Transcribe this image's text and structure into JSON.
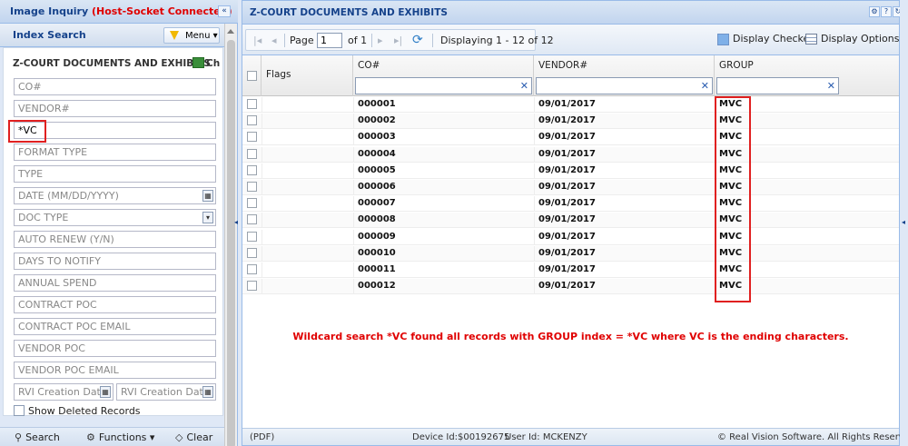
{
  "left": {
    "title": "Image Inquiry",
    "status": "(Host-Socket Connected)",
    "collapse_icon": "«",
    "index_search_label": "Index Search",
    "menu_label": "Menu",
    "form_heading": "Z-COURT DOCUMENTS AND EXHIBITS",
    "form_heading_trail": "Ch",
    "fields": {
      "co": "CO#",
      "vendor": "VENDOR#",
      "group_value": "*VC",
      "format_type": "FORMAT TYPE",
      "type": "TYPE",
      "date": "DATE (MM/DD/YYYY)",
      "doc_type": "DOC TYPE",
      "auto_renew": "AUTO RENEW (Y/N)",
      "days_to_notify": "DAYS TO NOTIFY",
      "annual_spend": "ANNUAL SPEND",
      "contract_poc": "CONTRACT POC",
      "contract_poc_email": "CONTRACT POC EMAIL",
      "vendor_poc": "VENDOR POC",
      "vendor_poc_email": "VENDOR POC EMAIL",
      "rvi_creation_date_1": "RVI Creation Date",
      "rvi_creation_date_2": "RVI Creation Date"
    },
    "show_deleted": "Show Deleted Records",
    "bottom": {
      "search": "Search",
      "functions": "Functions ▾",
      "clear": "Clear"
    }
  },
  "right": {
    "title": "Z-COURT DOCUMENTS AND EXHIBITS",
    "pager": {
      "page_label": "Page",
      "page_value": "1",
      "of_label": "of 1",
      "displaying": "Displaying 1 - 12 of 12"
    },
    "display_checked": "Display Checked",
    "display_options": "Display Options ▾",
    "columns": {
      "flags": "Flags",
      "co": "CO#",
      "vendor": "VENDOR#",
      "group": "GROUP"
    },
    "rows": [
      {
        "co": "000001",
        "vendor": "09/01/2017",
        "group": "MVC"
      },
      {
        "co": "000002",
        "vendor": "09/01/2017",
        "group": "MVC"
      },
      {
        "co": "000003",
        "vendor": "09/01/2017",
        "group": "MVC"
      },
      {
        "co": "000004",
        "vendor": "09/01/2017",
        "group": "MVC"
      },
      {
        "co": "000005",
        "vendor": "09/01/2017",
        "group": "MVC"
      },
      {
        "co": "000006",
        "vendor": "09/01/2017",
        "group": "MVC"
      },
      {
        "co": "000007",
        "vendor": "09/01/2017",
        "group": "MVC"
      },
      {
        "co": "000008",
        "vendor": "09/01/2017",
        "group": "MVC"
      },
      {
        "co": "000009",
        "vendor": "09/01/2017",
        "group": "MVC"
      },
      {
        "co": "000010",
        "vendor": "09/01/2017",
        "group": "MVC"
      },
      {
        "co": "000011",
        "vendor": "09/01/2017",
        "group": "MVC"
      },
      {
        "co": "000012",
        "vendor": "09/01/2017",
        "group": "MVC"
      }
    ],
    "note": "Wildcard search *VC found all records with GROUP index = *VC where VC is the ending characters.",
    "status": {
      "pdf": "(PDF)",
      "device": "Device Id:$00192675",
      "user": "User Id: MCKENZY",
      "copyright": "© Real Vision Software. All Rights Reserved."
    }
  },
  "colors": {
    "accent_title": "#15428b",
    "status_red": "#e00000",
    "highlight_box": "#e02020"
  }
}
